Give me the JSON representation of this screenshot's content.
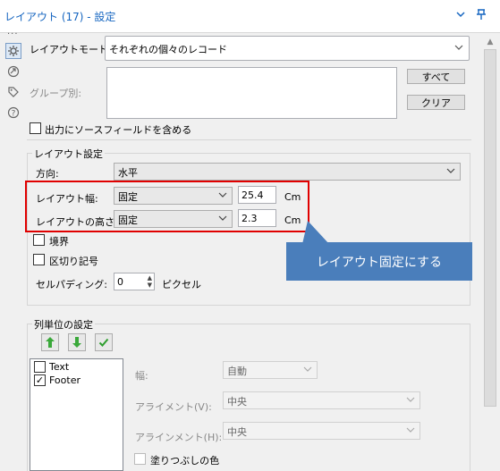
{
  "title": "レイアウト (17) - 設定",
  "layout_mode": {
    "label": "レイアウトモード:",
    "value": "それぞれの個々のレコード"
  },
  "group_by": {
    "label": "グループ別:",
    "select_all": "すべて",
    "clear": "クリア"
  },
  "include_source": {
    "label": "出力にソースフィールドを含める",
    "checked": false
  },
  "layout_settings": {
    "header": "レイアウト設定",
    "direction": {
      "label": "方向:",
      "value": "水平"
    },
    "width": {
      "label": "レイアウト幅:",
      "mode": "固定",
      "value": "25.4",
      "unit": "Cm"
    },
    "height": {
      "label": "レイアウトの高さ:",
      "mode": "固定",
      "value": "2.3",
      "unit": "Cm"
    },
    "border": {
      "label": "境界",
      "checked": false
    },
    "separator": {
      "label": "区切り記号",
      "checked": false
    },
    "cell_padding": {
      "label": "セルパディング:",
      "value": "0",
      "unit": "ピクセル"
    }
  },
  "callout": {
    "text": "レイアウト固定にする"
  },
  "column_settings": {
    "header": "列単位の設定",
    "fields": [
      {
        "label": "Text",
        "checked": false
      },
      {
        "label": "Footer",
        "checked": true
      }
    ],
    "width": {
      "label": "幅:",
      "value": "自動"
    },
    "alignment_v": {
      "label": "アライメント(V):",
      "value": "中央"
    },
    "alignment_h": {
      "label": "アラインメント(H):",
      "value": "中央"
    },
    "fill_color": {
      "label": "塗りつぶしの色",
      "checked": false
    }
  },
  "icons": {
    "collapse": "chevron-down-icon",
    "pin": "pin-icon",
    "config": "gear-icon",
    "tags": "tag-icon",
    "help": "help-icon",
    "move_up": "arrow-up-icon",
    "move_down": "arrow-down-icon",
    "confirm": "checkmark-icon"
  },
  "colors": {
    "title": "#1565c0",
    "highlight_border": "#e00000",
    "callout_bg": "#4a7ebb"
  }
}
